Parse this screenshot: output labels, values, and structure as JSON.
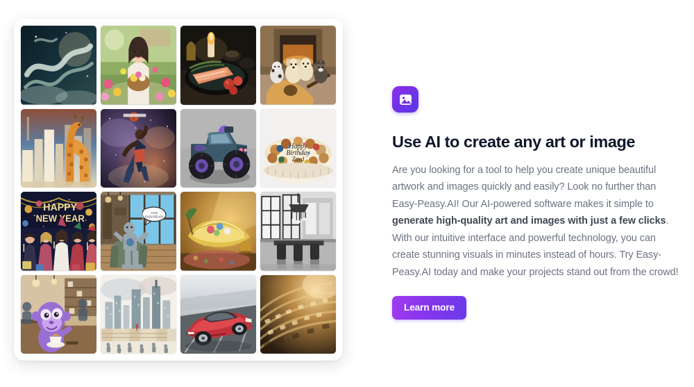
{
  "page": {
    "background": "#ffffff",
    "accent": "#6a3ae8"
  },
  "gallery": {
    "name": "ai-image-gallery",
    "columns": 4,
    "rows": 4,
    "tiles": [
      {
        "id": "tile-1",
        "alt": "Green and white Chinese dragon coiling through starry clouds",
        "theme": "dragon"
      },
      {
        "id": "tile-2",
        "alt": "Smiling woman in floral kimono holding a basket of flowers in a garden",
        "theme": "woman-flowers"
      },
      {
        "id": "tile-3",
        "alt": "Grilled salmon fillet with tomatoes and a lit candle on a dark table",
        "theme": "salmon-dinner"
      },
      {
        "id": "tile-4",
        "alt": "Group of puppies sitting on an acoustic guitar by a fireplace",
        "theme": "puppies-guitar"
      },
      {
        "id": "tile-5",
        "alt": "Painted giraffe standing among colorful city skyscrapers",
        "theme": "giraffe-city"
      },
      {
        "id": "tile-6",
        "alt": "Basketball player dunking against a cosmic nebula background",
        "theme": "dunk-nebula"
      },
      {
        "id": "tile-7",
        "alt": "Purple and teal monster truck with oversized tires on grey backdrop",
        "theme": "monster-truck"
      },
      {
        "id": "tile-8",
        "alt": "Decorated birthday cake reading Happy Birthday Zayd",
        "theme": "birthday-cake"
      },
      {
        "id": "tile-9",
        "alt": "Happy New Year party scene with people celebrating under garlands",
        "theme": "new-year-party"
      },
      {
        "id": "tile-10",
        "alt": "Comic style robot relaxing in an armchair with a speech bubble",
        "theme": "robot-armchair"
      },
      {
        "id": "tile-11",
        "alt": "Golden lit banana and fruit bowl still life in a warm room",
        "theme": "banana-stilllife"
      },
      {
        "id": "tile-12",
        "alt": "Black and white luxury dining room with chandelier and tall windows",
        "theme": "dining-bw"
      },
      {
        "id": "tile-13",
        "alt": "Purple cartoon monkey drinking coffee in a busy cafe",
        "theme": "monkey-cafe"
      },
      {
        "id": "tile-14",
        "alt": "Watercolor painting of a city skyline above shophouse street",
        "theme": "city-watercolor"
      },
      {
        "id": "tile-15",
        "alt": "Red sports car speeding along a highway",
        "theme": "red-supercar"
      },
      {
        "id": "tile-16",
        "alt": "Close up macro of golden textured surface with shallow depth of field",
        "theme": "golden-macro"
      }
    ]
  },
  "promo": {
    "icon_name": "image-icon",
    "title": "Use AI to create any art or image",
    "body_part1": "Are you looking for a tool to help you create unique beautiful artwork and images quickly and easily? Look no further than Easy-Peasy.AI! Our AI-powered software makes it simple to ",
    "body_bold": "generate high-quality art and images with just a few clicks",
    "body_part2": ". With our intuitive interface and powerful technology, you can create stunning visuals in minutes instead of hours. Try Easy-Peasy.AI today and make your projects stand out from the crowd!",
    "cta_label": "Learn more"
  }
}
